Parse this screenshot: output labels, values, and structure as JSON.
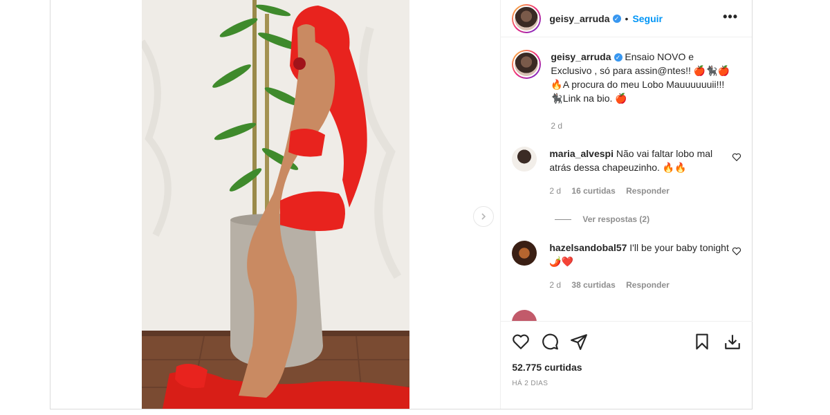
{
  "post": {
    "username": "geisy_arruda",
    "follow_label": "Seguir",
    "more_label": "•••",
    "caption": {
      "username": "geisy_arruda",
      "text": "Ensaio NOVO e Exclusivo , só para assin@ntes!! 🍎🐈‍⬛🍎🔥A procura do meu Lobo Mauuuuuuii!!! 🐈‍⬛Link na bio. 🍎",
      "time": "2 d"
    },
    "comments": [
      {
        "username": "maria_alvespi",
        "text": "Não vai faltar lobo mal atrás dessa chapeuzinho. 🔥🔥",
        "time": "2 d",
        "likes": "16 curtidas",
        "reply_label": "Responder",
        "view_replies": "Ver respostas (2)"
      },
      {
        "username": "hazelsandobal57",
        "text": "I'll be your baby tonight🌶️❤️",
        "time": "2 d",
        "likes": "38 curtidas",
        "reply_label": "Responder"
      }
    ],
    "likes": "52.775 curtidas",
    "posted_ago": "HÁ 2 DIAS"
  },
  "colors": {
    "accent": "#0095f6",
    "verified": "#3897f0",
    "muted": "#8e8e8e",
    "dress": "#e8231e"
  },
  "icons": [
    "heart-icon",
    "comment-icon",
    "share-icon",
    "bookmark-icon",
    "download-icon",
    "chevron-right-icon",
    "verified-badge-icon",
    "more-options-icon"
  ]
}
